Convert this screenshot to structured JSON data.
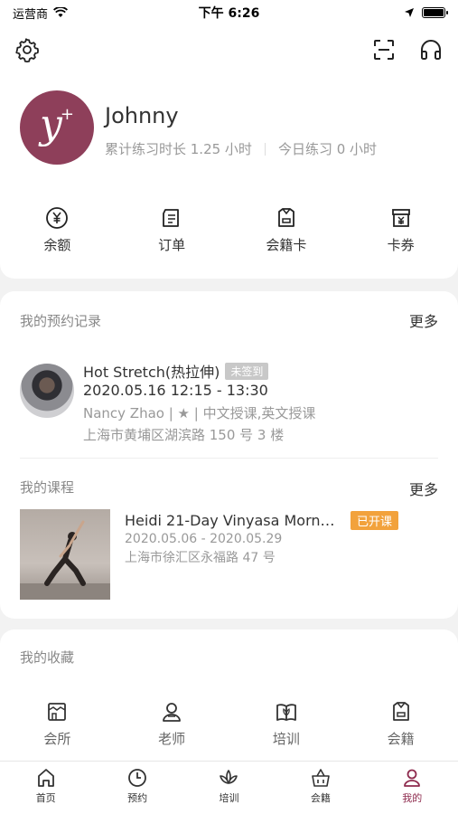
{
  "status_bar": {
    "carrier": "运营商",
    "time": "下午 6:26",
    "battery_level": 1.0
  },
  "user": {
    "avatar_text": "y",
    "avatar_sup": "+",
    "name": "Johnny",
    "total_practice": "累计练习时长 1.25 小时",
    "today_practice": "今日练习 0 小时"
  },
  "quick_actions": [
    {
      "label": "余额",
      "icon": "yuan-circle-icon"
    },
    {
      "label": "订单",
      "icon": "order-icon"
    },
    {
      "label": "会籍卡",
      "icon": "membership-card-icon"
    },
    {
      "label": "卡券",
      "icon": "coupon-icon"
    }
  ],
  "bookings": {
    "title": "我的预约记录",
    "more": "更多",
    "item": {
      "title": "Hot Stretch(热拉伸)",
      "status": "未签到",
      "time": "2020.05.16 12:15 - 13:30",
      "teacher": "Nancy Zhao | ★ | 中文授课,英文授课",
      "address": "上海市黄埔区湖滨路 150 号 3 楼"
    }
  },
  "courses": {
    "title": "我的课程",
    "more": "更多",
    "item": {
      "title": "Heidi 21-Day Vinyasa Morning",
      "status": "已开课",
      "dates": "2020.05.06 - 2020.05.29",
      "address": "上海市徐汇区永福路 47 号"
    }
  },
  "favorites": {
    "title": "我的收藏",
    "items": [
      {
        "label": "会所",
        "icon": "studio-icon"
      },
      {
        "label": "老师",
        "icon": "teacher-icon"
      },
      {
        "label": "培训",
        "icon": "training-book-icon"
      },
      {
        "label": "会籍",
        "icon": "membership-icon"
      }
    ]
  },
  "tabs": [
    {
      "label": "首页",
      "icon": "home-icon",
      "active": false
    },
    {
      "label": "预约",
      "icon": "clock-icon",
      "active": false
    },
    {
      "label": "培训",
      "icon": "lotus-icon",
      "active": false
    },
    {
      "label": "会籍",
      "icon": "basket-icon",
      "active": false
    },
    {
      "label": "我的",
      "icon": "person-icon",
      "active": true
    }
  ],
  "colors": {
    "accent": "#8e2b4e",
    "badge_orange": "#f2a23c",
    "badge_gray": "#c8c8c8",
    "avatar_bg": "#8e3f5a"
  }
}
